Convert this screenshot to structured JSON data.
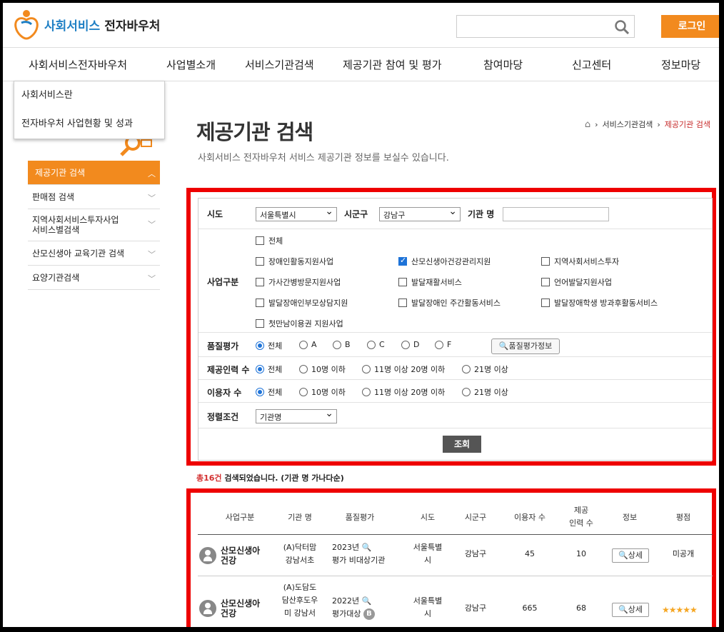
{
  "header": {
    "logo_primary": "사회서비스",
    "logo_secondary": "전자바우처",
    "search_placeholder": "",
    "login_label": "로그인"
  },
  "gnb": [
    "사회서비스전자바우처",
    "사업별소개",
    "서비스기관검색",
    "제공기관 참여 및 평가",
    "참여마당",
    "신고센터",
    "정보마당"
  ],
  "dropdown": [
    "사회서비스란",
    "전자바우처 사업현황 및 성과"
  ],
  "lnb": [
    {
      "label": "제공기관 검색",
      "active": true
    },
    {
      "label": "판매점 검색",
      "active": false
    },
    {
      "label": "지역사회서비스투자사업\n서비스별검색",
      "active": false
    },
    {
      "label": "산모신생아 교육기관 검색",
      "active": false
    },
    {
      "label": "요양기관검색",
      "active": false
    }
  ],
  "page": {
    "title": "제공기관 검색",
    "description": "사회서비스 전자바우처 서비스 제공기관 정보를 보실수 있습니다."
  },
  "breadcrumb": {
    "home": "⌂",
    "level1": "서비스기관검색",
    "current": "제공기관 검색"
  },
  "form": {
    "sido_label": "시도",
    "sido_value": "서울특별시",
    "sigungu_label": "시군구",
    "sigungu_value": "강남구",
    "org_label": "기관 명",
    "org_value": "",
    "biz_label": "사업구분",
    "biz_options": [
      {
        "label": "전체",
        "checked": false
      },
      {
        "label": "장애인활동지원사업",
        "checked": false
      },
      {
        "label": "산모신생아건강관리지원",
        "checked": true
      },
      {
        "label": "지역사회서비스투자",
        "checked": false
      },
      {
        "label": "가사간병방문지원사업",
        "checked": false
      },
      {
        "label": "발달재활서비스",
        "checked": false
      },
      {
        "label": "언어발달지원사업",
        "checked": false
      },
      {
        "label": "발달장애인부모상담지원",
        "checked": false
      },
      {
        "label": "발달장애인 주간활동서비스",
        "checked": false
      },
      {
        "label": "발달장애학생 방과후활동서비스",
        "checked": false
      },
      {
        "label": "첫만남이용권 지원사업",
        "checked": false
      }
    ],
    "quality_label": "품질평가",
    "quality_options": [
      "전체",
      "A",
      "B",
      "C",
      "D",
      "F"
    ],
    "quality_selected": "전체",
    "quality_info_button": "품질평가정보",
    "staff_label": "제공인력 수",
    "staff_options": [
      "전체",
      "10명 이하",
      "11명 이상 20명 이하",
      "21명 이상"
    ],
    "users_label": "이용자 수",
    "users_options": [
      "전체",
      "10명 이하",
      "11명 이상 20명 이하",
      "21명 이상"
    ],
    "sort_label": "정렬조건",
    "sort_value": "기관명",
    "search_button": "조회"
  },
  "result": {
    "count": "총16건",
    "suffix": "검색되었습니다. (기관 명 가나다순)"
  },
  "table": {
    "headers": [
      "사업구분",
      "기관 명",
      "품질평가",
      "시도",
      "시군구",
      "이용자 수",
      "제공\n인력 수",
      "정보",
      "평점"
    ],
    "rows": [
      {
        "category": "산모신생아\n건강",
        "org": "(A)닥터맘\n강남서초",
        "quality": "2023년 🔍\n평가 비대상기관",
        "grade": "",
        "sido": "서울특별\n시",
        "sigungu": "강남구",
        "users": "45",
        "staff": "10",
        "detail": "상세",
        "rating": "미공개"
      },
      {
        "category": "산모신생아\n건강",
        "org": "(A)도담도\n담산후도우\n미 강남서",
        "quality": "2022년 🔍\n평가대상",
        "grade": "B",
        "sido": "서울특별\n시",
        "sigungu": "강남구",
        "users": "665",
        "staff": "68",
        "detail": "상세",
        "rating": "★★★★★"
      }
    ]
  },
  "colors": {
    "accent": "#f28a1e",
    "highlight": "#ee0000",
    "brand": "#1e7fc4"
  }
}
